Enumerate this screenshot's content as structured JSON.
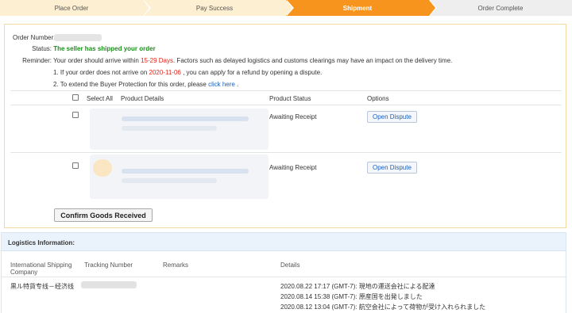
{
  "steps": [
    {
      "label": "Place Order"
    },
    {
      "label": "Pay Success"
    },
    {
      "label": "Shipment"
    },
    {
      "label": "Order Complete"
    }
  ],
  "order": {
    "order_number_label": "Order Number:",
    "status_label": "Status:",
    "status_text": "The seller has shipped your order",
    "reminder_label": "Reminder:",
    "reminder_prefix": "Your order should arrive within ",
    "reminder_days": "15-29 Days",
    "reminder_suffix": ". Factors such as delayed logistics and customs clearings may have an impact on the delivery time.",
    "note1_prefix": "1. If your order does not arrive on ",
    "note1_date": "2020-11-06",
    "note1_suffix": " , you can apply for a refund by opening a dispute.",
    "note2_prefix": "2. To extend the Buyer Protection for this order, please ",
    "note2_link": "click here",
    "note2_suffix": " ."
  },
  "table": {
    "select_all": "Select All",
    "col_product": "Product Details",
    "col_status": "Product Status",
    "col_options": "Options",
    "items": [
      {
        "status": "Awaiting Receipt",
        "button": "Open Dispute"
      },
      {
        "status": "Awaiting Receipt",
        "button": "Open Dispute"
      }
    ],
    "confirm_button": "Confirm Goods Received"
  },
  "logistics": {
    "title": "Logistics Information:",
    "col_company_line1": "International Shipping",
    "col_company_line2": "Company",
    "col_tracking": "Tracking Number",
    "col_remarks": "Remarks",
    "col_details": "Details",
    "company": "黒ル特貨专线－经济线",
    "details": [
      "2020.08.22 17:17 (GMT-7): 現地の運送会社による配達",
      "2020.08.14 15:38 (GMT-7): 原産国を出発しました",
      "2020.08.12 13:04 (GMT-7): 航空会社によって荷物が受け入れられました"
    ]
  }
}
